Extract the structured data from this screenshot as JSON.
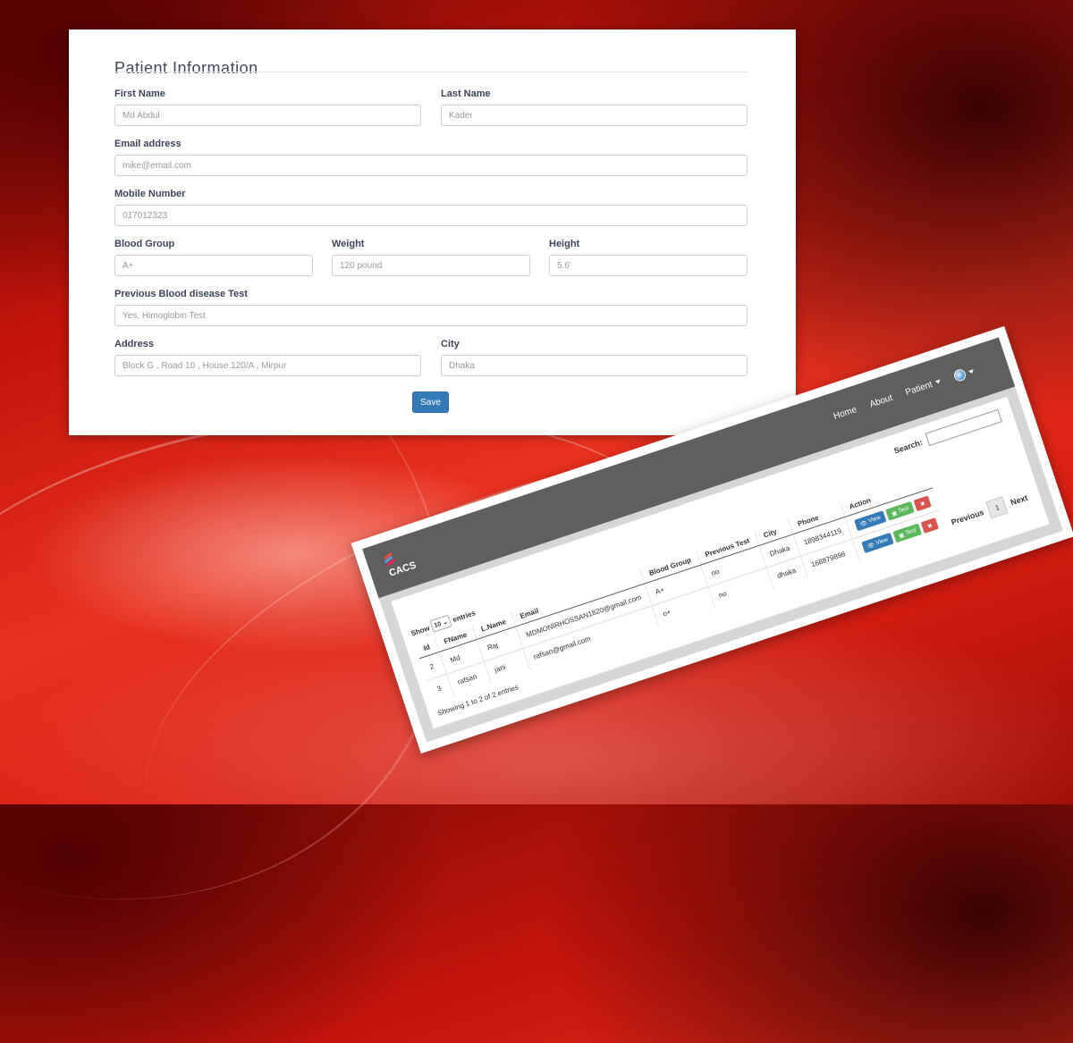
{
  "form": {
    "title": "Patient Information",
    "first_name_label": "First Name",
    "first_name_value": "Md Abdul",
    "last_name_label": "Last Name",
    "last_name_value": "Kader",
    "email_label": "Email address",
    "email_value": "mike@email.com",
    "mobile_label": "Mobile Number",
    "mobile_value": "017012323",
    "blood_group_label": "Blood Group",
    "blood_group_value": "A+",
    "weight_label": "Weight",
    "weight_value": "120 pound",
    "height_label": "Height",
    "height_value": "5.6'",
    "prev_test_label": "Previous Blood disease Test",
    "prev_test_value": "Yes, Himoglobin Test",
    "address_label": "Address",
    "address_value": "Block G , Road 10 , House 120/A , Mirpur",
    "city_label": "City",
    "city_value": "Dhaka",
    "save_label": "Save"
  },
  "app": {
    "brand": "CACS",
    "nav": {
      "home": "Home",
      "about": "About",
      "patient": "Patient"
    },
    "search_label": "Search:",
    "show_prefix": "Show",
    "show_value": "10",
    "show_suffix": "entries",
    "columns": [
      "Id",
      "FName",
      "L.Name",
      "Email",
      "Blood Group",
      "Previous Test",
      "City",
      "Phone",
      "Action"
    ],
    "rows": [
      {
        "id": "2",
        "fname": "Md",
        "lname": "Raj",
        "email": "MDMONIRHOSSAN1820@gmail.com",
        "blood": "A+",
        "prev": "no",
        "city": "Dhaka",
        "phone": "1898344119"
      },
      {
        "id": "3",
        "fname": "rafsan",
        "lname": "jani",
        "email": "rafsan@gmail.com",
        "blood": "o+",
        "prev": "no",
        "city": "dhaka",
        "phone": "168879896"
      }
    ],
    "view_label": "View",
    "test_label": "Test",
    "delete_label": "✖",
    "info_text": "Showing 1 to 2 of 2 entries",
    "previous_label": "Previous",
    "page_label": "1",
    "next_label": "Next"
  }
}
